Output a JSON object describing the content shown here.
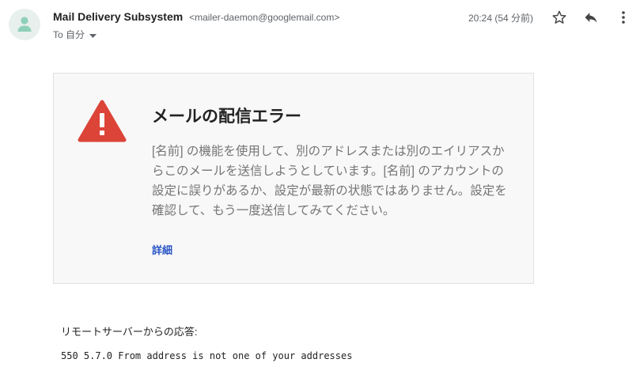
{
  "header": {
    "sender_name": "Mail Delivery Subsystem",
    "sender_email": "<mailer-daemon@googlemail.com>",
    "to_label": "To 自分",
    "timestamp": "20:24 (54 分前)",
    "avatar_icon": "person-icon",
    "actions": [
      "star-icon",
      "reply-icon",
      "more-vert-icon"
    ]
  },
  "error_card": {
    "icon": "warning-icon",
    "icon_color": "#db4437",
    "title": "メールの配信エラー",
    "body": "[名前] の機能を使用して、別のアドレスまたは別のエイリアスからこのメールを送信しようとしています。[名前] のアカウントの設定に誤りがあるか、設定が最新の状態ではありません。設定を確認して、もう一度送信してみてください。",
    "details_link": "詳細",
    "link_color": "#2a56c6"
  },
  "remote": {
    "label": "リモートサーバーからの応答:",
    "response": "550 5.7.0 From address is not one of your addresses"
  }
}
